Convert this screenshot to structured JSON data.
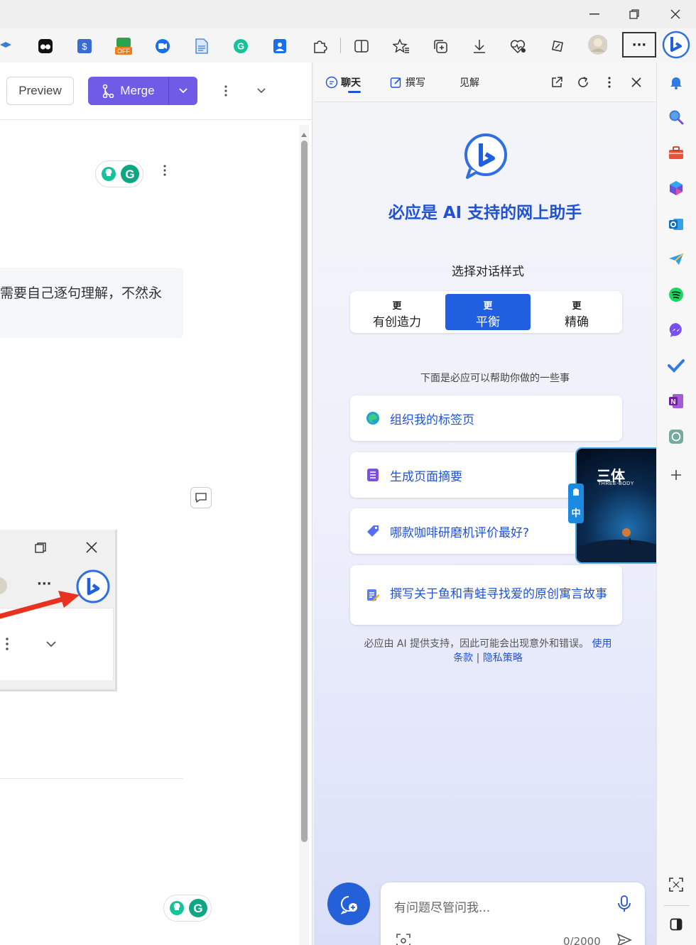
{
  "window": {
    "minimize": "—",
    "restore": "❐",
    "close": "✕"
  },
  "toolbar": {
    "more": "···"
  },
  "left_page": {
    "preview_label": "Preview",
    "merge_label": "Merge",
    "merge_dropdown": "⌄",
    "more": "⋮",
    "collapse": "⌄",
    "comment_text": "需要自己逐句理解，不然永",
    "inner_more": "···",
    "inner_kebab": "⋮",
    "inner_chevron": "⌄"
  },
  "copilot": {
    "tabs": [
      {
        "label": "聊天",
        "icon": "chat-icon",
        "active": true
      },
      {
        "label": "撰写",
        "icon": "compose-icon",
        "active": false
      },
      {
        "label": "见解",
        "icon": "",
        "active": false
      }
    ],
    "title": "必应是 AI 支持的网上助手",
    "style_label": "选择对话样式",
    "styles": [
      {
        "top": "更",
        "bottom": "有创造力",
        "selected": false
      },
      {
        "top": "更",
        "bottom": "平衡",
        "selected": true
      },
      {
        "top": "更",
        "bottom": "精确",
        "selected": false
      }
    ],
    "help_label": "下面是必应可以帮助你做的一些事",
    "suggestions": [
      {
        "text": "组织我的标签页",
        "icon": "edge-icon"
      },
      {
        "text": "生成页面摘要",
        "icon": "list-icon"
      },
      {
        "text": "哪款咖啡研磨机评价最好?",
        "icon": "tag-icon"
      },
      {
        "text": "撰写关于鱼和青蛙寻找爱的原创寓言故事",
        "icon": "pen-icon"
      }
    ],
    "disclaimer": "必应由 AI 提供支持，因此可能会出现意外和错误。",
    "disclaimer_link_1": "使用",
    "disclaimer_link_2": "条款",
    "disclaimer_sep": " | ",
    "disclaimer_link_3": "隐私策略",
    "input_placeholder": "有问题尽管问我...",
    "char_count": "0/2000",
    "floating_ad": {
      "title": "三体",
      "subtitle": "THREE-BODY",
      "badge": "中"
    }
  },
  "colors": {
    "accent": "#2152d4",
    "merge": "#6e5ce6",
    "selected_style": "#1f5fe0",
    "new_topic": "#2460d8"
  }
}
